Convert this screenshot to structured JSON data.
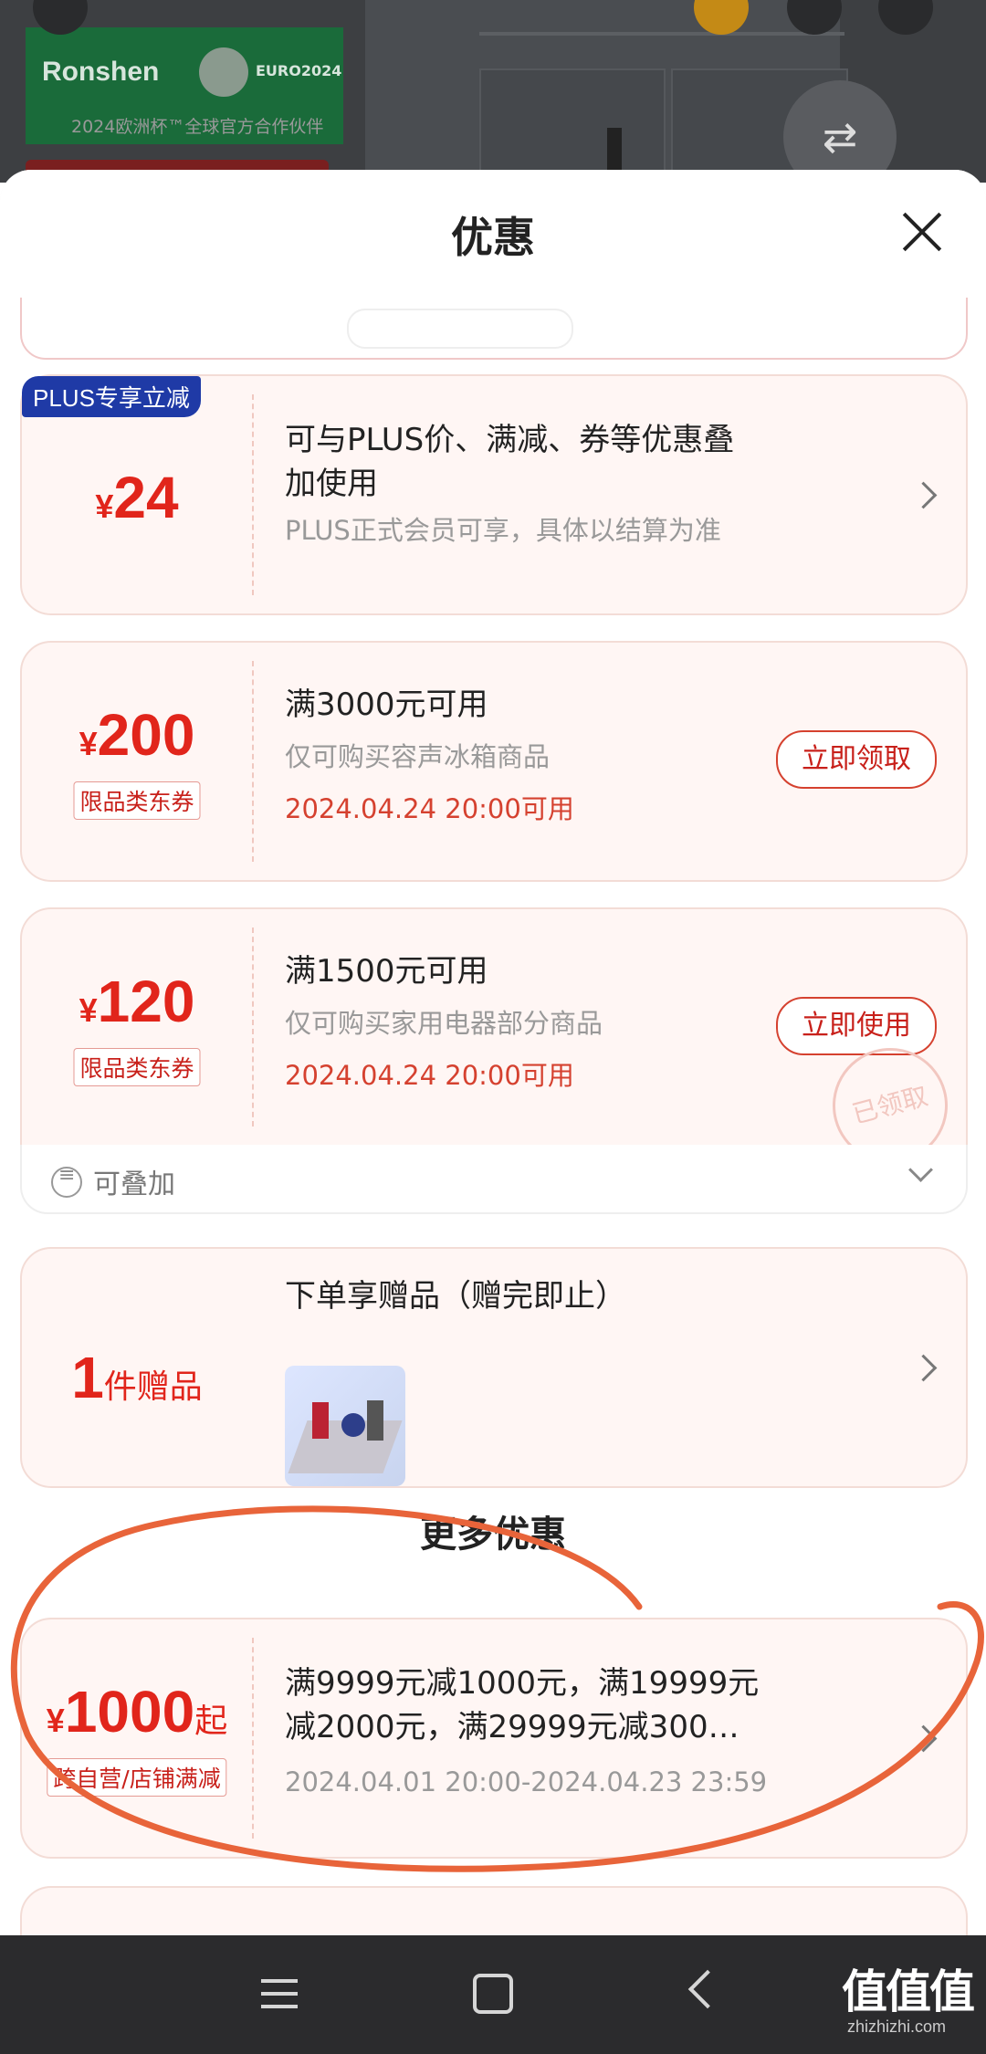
{
  "background": {
    "brand_name": "Ronshen",
    "euro_logo": "EURO2024",
    "brand_tagline": "2024欧洲杯™全球官方合作伙伴"
  },
  "sheet": {
    "title": "优惠"
  },
  "coupons": [
    {
      "badge": "PLUS专享立减",
      "yen": "¥",
      "amount": "24",
      "title_line1": "可与PLUS价、满减、券等优惠叠",
      "title_line2": "加使用",
      "subtitle": "PLUS正式会员可享，具体以结算为准"
    },
    {
      "yen": "¥",
      "amount": "200",
      "tag": "限品类东券",
      "title": "满3000元可用",
      "subtitle": "仅可购买容声冰箱商品",
      "date": "2024.04.24 20:00可用",
      "button": "立即领取"
    },
    {
      "yen": "¥",
      "amount": "120",
      "tag": "限品类东券",
      "title": "满1500元可用",
      "subtitle": "仅可购买家用电器部分商品",
      "date": "2024.04.24 20:00可用",
      "button": "立即使用",
      "stamp": "已领取",
      "stackable": "可叠加"
    },
    {
      "amount": "1",
      "suffix": "件赠品",
      "title": "下单享赠品（赠完即止）"
    }
  ],
  "more": {
    "section_title": "更多优惠",
    "coupon": {
      "yen": "¥",
      "amount": "1000",
      "suffix": "起",
      "tag": "跨自营/店铺满减",
      "title_line1": "满9999元减1000元，满19999元",
      "title_line2": "减2000元，满29999元减300…",
      "date": "2024.04.01 20:00-2024.04.23 23:59"
    }
  },
  "watermark": {
    "text": "值值值",
    "sub": "zhizhizhi.com"
  },
  "colors": {
    "accent": "#e1251b",
    "plus_badge": "#1f3aa6",
    "annotation": "#e8643a"
  }
}
